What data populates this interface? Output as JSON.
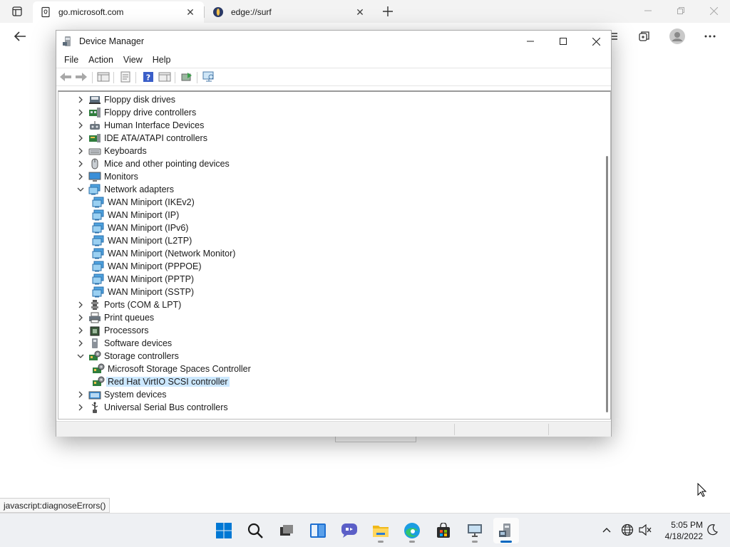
{
  "browser": {
    "tabs": [
      {
        "title": "go.microsoft.com",
        "active": true
      },
      {
        "title": "edge://surf",
        "active": false
      }
    ],
    "status_url": "javascript:diagnoseErrors()"
  },
  "device_manager": {
    "title": "Device Manager",
    "menu": [
      "File",
      "Action",
      "View",
      "Help"
    ],
    "tree": [
      {
        "label": "Floppy disk drives",
        "icon": "floppy-disk-icon",
        "level": 0,
        "state": "collapsed"
      },
      {
        "label": "Floppy drive controllers",
        "icon": "floppy-controller-icon",
        "level": 0,
        "state": "collapsed"
      },
      {
        "label": "Human Interface Devices",
        "icon": "hid-icon",
        "level": 0,
        "state": "collapsed"
      },
      {
        "label": "IDE ATA/ATAPI controllers",
        "icon": "ide-controller-icon",
        "level": 0,
        "state": "collapsed"
      },
      {
        "label": "Keyboards",
        "icon": "keyboard-icon",
        "level": 0,
        "state": "collapsed"
      },
      {
        "label": "Mice and other pointing devices",
        "icon": "mouse-icon",
        "level": 0,
        "state": "collapsed"
      },
      {
        "label": "Monitors",
        "icon": "monitor-icon",
        "level": 0,
        "state": "collapsed"
      },
      {
        "label": "Network adapters",
        "icon": "network-adapter-icon",
        "level": 0,
        "state": "expanded"
      },
      {
        "label": "WAN Miniport (IKEv2)",
        "icon": "network-adapter-icon",
        "level": 1,
        "state": "leaf"
      },
      {
        "label": "WAN Miniport (IP)",
        "icon": "network-adapter-icon",
        "level": 1,
        "state": "leaf"
      },
      {
        "label": "WAN Miniport (IPv6)",
        "icon": "network-adapter-icon",
        "level": 1,
        "state": "leaf"
      },
      {
        "label": "WAN Miniport (L2TP)",
        "icon": "network-adapter-icon",
        "level": 1,
        "state": "leaf"
      },
      {
        "label": "WAN Miniport (Network Monitor)",
        "icon": "network-adapter-icon",
        "level": 1,
        "state": "leaf"
      },
      {
        "label": "WAN Miniport (PPPOE)",
        "icon": "network-adapter-icon",
        "level": 1,
        "state": "leaf"
      },
      {
        "label": "WAN Miniport (PPTP)",
        "icon": "network-adapter-icon",
        "level": 1,
        "state": "leaf"
      },
      {
        "label": "WAN Miniport (SSTP)",
        "icon": "network-adapter-icon",
        "level": 1,
        "state": "leaf"
      },
      {
        "label": "Ports (COM & LPT)",
        "icon": "port-icon",
        "level": 0,
        "state": "collapsed"
      },
      {
        "label": "Print queues",
        "icon": "printer-icon",
        "level": 0,
        "state": "collapsed"
      },
      {
        "label": "Processors",
        "icon": "processor-icon",
        "level": 0,
        "state": "collapsed"
      },
      {
        "label": "Software devices",
        "icon": "software-device-icon",
        "level": 0,
        "state": "collapsed"
      },
      {
        "label": "Storage controllers",
        "icon": "storage-controller-icon",
        "level": 0,
        "state": "expanded"
      },
      {
        "label": "Microsoft Storage Spaces Controller",
        "icon": "storage-controller-icon",
        "level": 1,
        "state": "leaf"
      },
      {
        "label": "Red Hat VirtIO SCSI controller",
        "icon": "storage-controller-icon",
        "level": 1,
        "state": "leaf",
        "selected": true
      },
      {
        "label": "System devices",
        "icon": "system-devices-icon",
        "level": 0,
        "state": "collapsed"
      },
      {
        "label": "Universal Serial Bus controllers",
        "icon": "usb-icon",
        "level": 0,
        "state": "collapsed"
      }
    ]
  },
  "taskbar": {
    "time": "5:05 PM",
    "date": "4/18/2022"
  },
  "colors": {
    "selection": "#cce8ff",
    "accent": "#0067c0"
  }
}
